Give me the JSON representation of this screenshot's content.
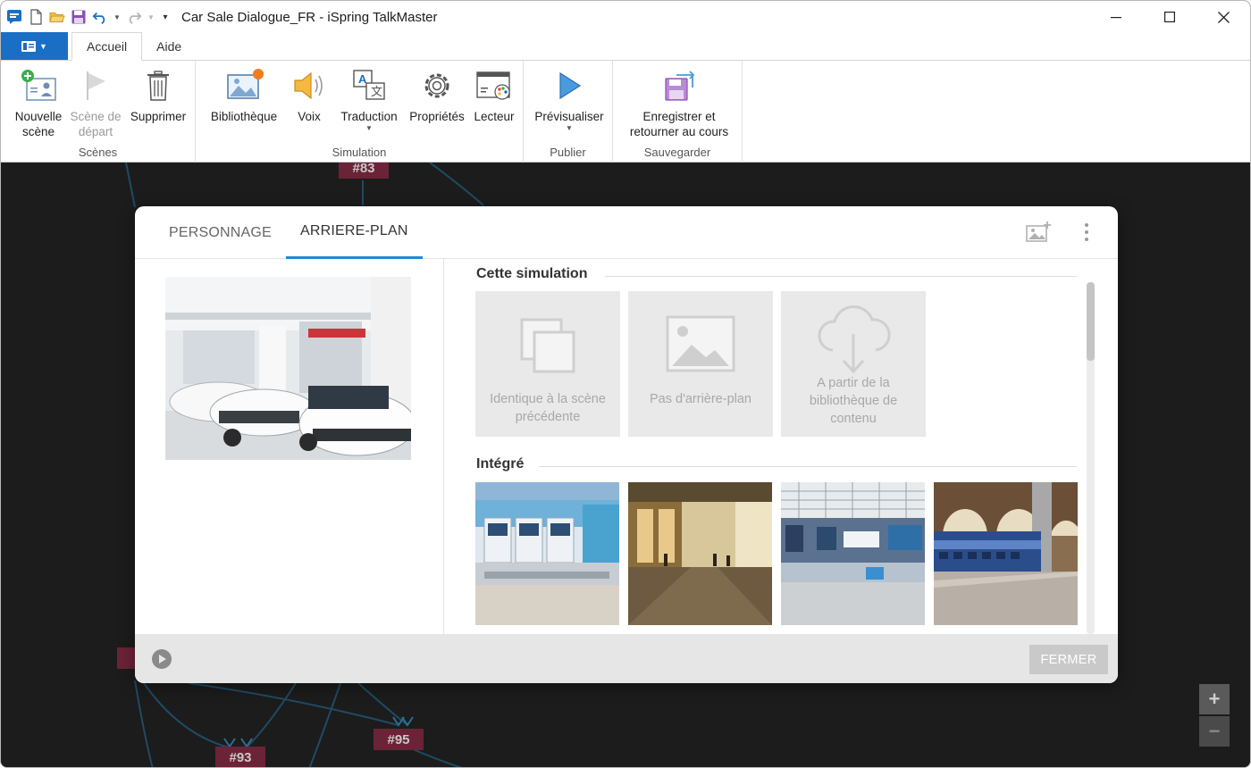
{
  "window": {
    "title": "Car Sale Dialogue_FR - iSpring TalkMaster"
  },
  "ribbon_tabs": [
    {
      "label": "Accueil"
    },
    {
      "label": "Aide"
    }
  ],
  "ribbon": {
    "scenes": {
      "label": "Scènes",
      "new_scene": "Nouvelle scène",
      "start_scene": "Scène de départ",
      "delete": "Supprimer"
    },
    "simulation": {
      "label": "Simulation",
      "library": "Bibliothèque",
      "voice": "Voix",
      "translation": "Traduction",
      "properties": "Propriétés",
      "player": "Lecteur"
    },
    "publish": {
      "label": "Publier",
      "preview": "Prévisualiser"
    },
    "save": {
      "label": "Sauvegarder",
      "save_return": "Enregistrer et retourner au cours"
    }
  },
  "canvas": {
    "nodes": [
      "#83",
      "#93",
      "#95"
    ],
    "zoom_in": "+",
    "zoom_out": "−"
  },
  "dialog": {
    "tabs": [
      {
        "label": "PERSONNAGE"
      },
      {
        "label": "ARRIERE-PLAN"
      }
    ],
    "section_simulation": "Cette simulation",
    "section_builtin": "Intégré",
    "options": [
      {
        "label": "Identique à la scène précédente",
        "icon": "copy-icon"
      },
      {
        "label": "Pas d'arrière-plan",
        "icon": "image-icon"
      },
      {
        "label": "A partir de la bibliothèque de contenu",
        "icon": "cloud-download-icon"
      }
    ],
    "close_label": "FERMER"
  },
  "colors": {
    "accent": "#1a8ad4",
    "file_button": "#1a6fc4",
    "node_fill": "#6b2338",
    "canvas_bg": "#1c1c1c"
  }
}
